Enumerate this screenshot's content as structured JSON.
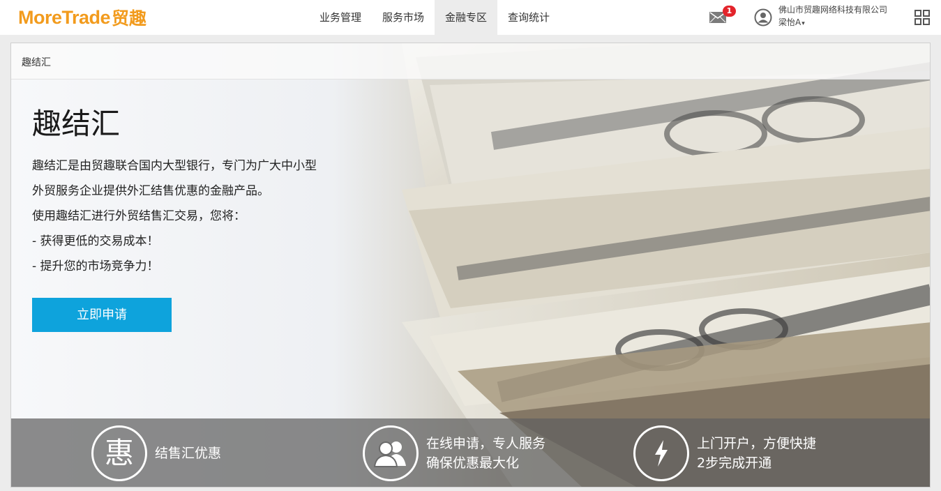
{
  "brand": {
    "logo_en": "MoreTrade",
    "logo_cn": "贸趣",
    "accent": "#f29b1d"
  },
  "nav": {
    "items": [
      {
        "label": "业务管理"
      },
      {
        "label": "服务市场"
      },
      {
        "label": "金融专区"
      },
      {
        "label": "查询统计"
      }
    ],
    "active_index": 2
  },
  "header": {
    "mail_icon": "mail-icon",
    "unread_count": "1",
    "company": "佛山市贸趣网络科技有限公司",
    "username": "梁怡A",
    "caret": "▾",
    "apps_icon": "grid-icon"
  },
  "breadcrumb": {
    "current": "趣结汇"
  },
  "hero": {
    "title": "趣结汇",
    "lines": [
      "趣结汇是由贸趣联合国内大型银行，专门为广大中小型",
      "外贸服务企业提供外汇结售优惠的金融产品。",
      "使用趣结汇进行外贸结售汇交易，您将：",
      "- 获得更低的交易成本！",
      "- 提升您的市场竞争力！"
    ],
    "cta_label": "立即申请",
    "cta_color": "#0ea3dc"
  },
  "features": [
    {
      "icon": "discount-icon",
      "glyph": "惠",
      "lines": [
        "结售汇优惠"
      ]
    },
    {
      "icon": "people-icon",
      "lines": [
        "在线申请，专人服务",
        "确保优惠最大化"
      ]
    },
    {
      "icon": "lightning-icon",
      "lines": [
        "上门开户，方便快捷",
        "2步完成开通"
      ]
    }
  ]
}
